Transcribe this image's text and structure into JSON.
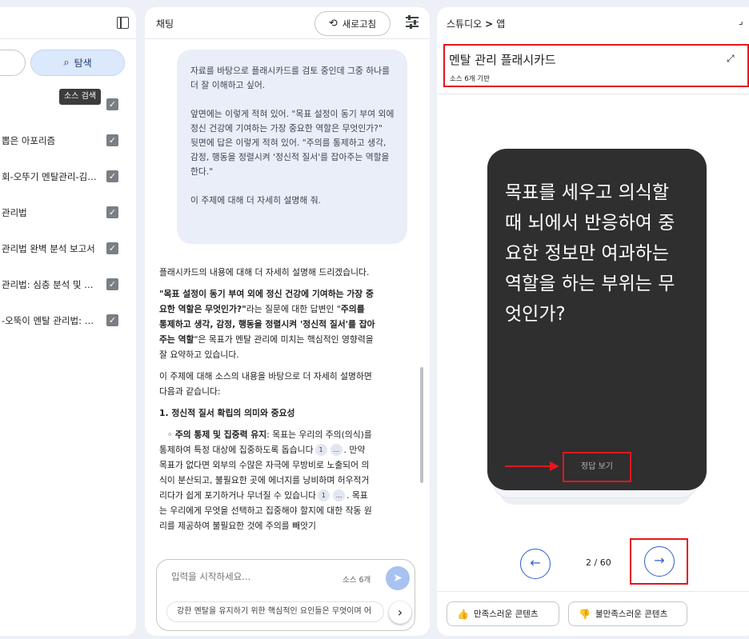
{
  "sources": {
    "explore_label": "탐색",
    "tooltip": "소스 검색",
    "items": [
      {
        "label": ""
      },
      {
        "label": "뽑은 아포리즘"
      },
      {
        "label": "회-오뚜기 멘탈관리-김권..."
      },
      {
        "label": "관리법"
      },
      {
        "label": "관리법 완벽 분석 보고서"
      },
      {
        "label": "관리법: 심층 분석 및 실..."
      },
      {
        "label": "-오뚝이 멘탈 관리법: 10..."
      }
    ]
  },
  "chat": {
    "title": "채팅",
    "refresh_label": "새로고침",
    "user_message": [
      "자료를 바탕으로 플래시카드를 검토 중인데 그중 하나를 더 잘 이해하고 싶어.",
      "앞면에는 이렇게 적혀 있어. \"목표 설정이 동기 부여 외에 정신 건강에 기여하는 가장 중요한 역할은 무엇인가?\"",
      "뒷면에 답은 이렇게 적혀 있어. \"주의를 통제하고 생각, 감정, 행동을 정렬시켜 '정신적 질서'를 잡아주는 역할을 한다.\"",
      "이 주제에 대해 더 자세히 설명해 줘."
    ],
    "answer": {
      "intro": "플래시카드의 내용에 대해 더 자세히 설명해 드리겠습니다.",
      "p2_bold1": "\"목표 설정이 동기 부여 외에 정신 건강에 기여하는 가장 중요한 역할은 무엇인가?\"",
      "p2_text1": "라는 질문에 대한 답변인 \"",
      "p2_bold2": "주의를 통제하고 생각, 감정, 행동을 정렬시켜 '정신적 질서'를 잡아주는 역할",
      "p2_text2": "\"은 목표가 멘탈 관리에 미치는 핵심적인 영향력을 잘 요약하고 있습니다.",
      "p3": "이 주제에 대해 소스의 내용을 바탕으로 더 자세히 설명하면 다음과 같습니다:",
      "heading": "1. 정신적 질서 확립의 의미와 중요성",
      "bullet_bold": "주의 통제 및 집중력 유지",
      "bullet_text1": ": 목표는 우리의 주의(의식)를 통제하여 특정 대상에 집중하도록 돕습니다",
      "cite1": "1",
      "cite_more": "...",
      "bullet_text2": ". 만약 목표가 없다면 외부의 수많은 자극에 무방비로 노출되어 의식이 분산되고, 불필요한 곳에 에너지를 낭비하며 허우적거리다가 쉽게 포기하거나 무너질 수 있습니다",
      "cite2": "1",
      "cite_more2": "...",
      "bullet_text3": ". 목표는 우리에게 무엇을 선택하고 집중해야 할지에 대한 작동 원리를 제공하여 불필요한 것에 주의를 빼앗기"
    },
    "input_placeholder": "입력을 시작하세요...",
    "source_count": "소스 6개",
    "suggestion": "강한 멘탈을 유지하기 위한 핵심적인 요인들은 무엇이며 어"
  },
  "studio": {
    "crumb_studio": "스튜디오",
    "crumb_sep": ">",
    "crumb_app": "앱",
    "title": "멘탈 관리 플래시카드",
    "based_on": "소스 6개 기반",
    "question": "목표를 세우고 의식할 때 뇌에서 반응하여 중요한 정보만 여과하는 역할을 하는 부위는 무엇인가?",
    "show_answer": "정답 보기",
    "page_indicator": "2 / 60",
    "good_label": "만족스러운 콘텐츠",
    "bad_label": "불만족스러운 콘텐츠"
  },
  "colors": {
    "accent": "#2d5fd0",
    "highlight": "#e5161d",
    "card": "#2f2f2f"
  }
}
